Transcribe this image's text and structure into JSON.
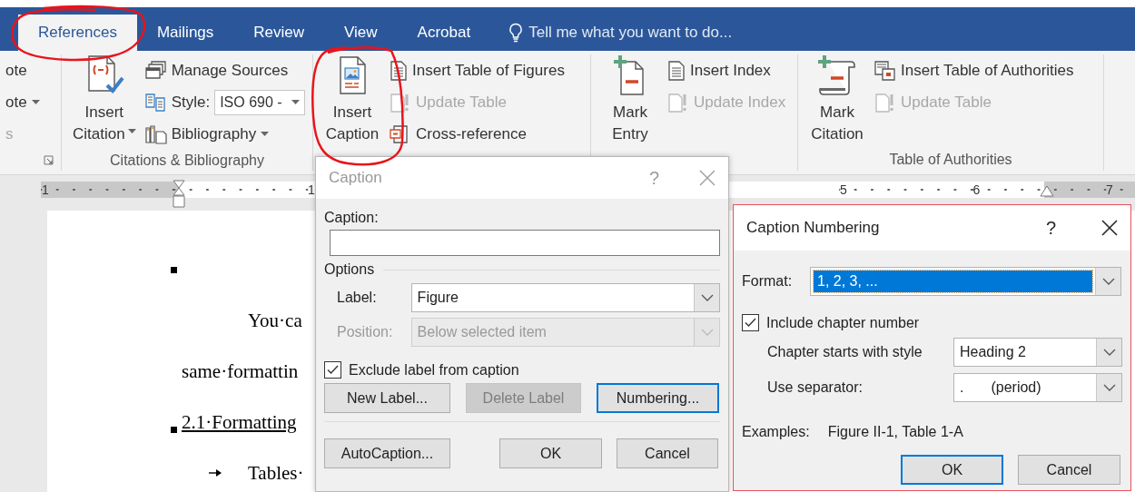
{
  "tabs": [
    {
      "label": "References",
      "selected": true
    },
    {
      "label": "Mailings",
      "selected": false
    },
    {
      "label": "Review",
      "selected": false
    },
    {
      "label": "View",
      "selected": false
    },
    {
      "label": "Acrobat",
      "selected": false
    }
  ],
  "tell_me": {
    "placeholder": "Tell me what you want to do..."
  },
  "ribbon": {
    "groups": [
      {
        "launcher": true,
        "small": [
          {
            "kind": "button",
            "label": "ote",
            "disabled": false,
            "dropdown": false
          },
          {
            "kind": "button",
            "label": "ote",
            "disabled": false,
            "dropdown": true
          },
          {
            "kind": "button",
            "label": "s",
            "disabled": true,
            "dropdown": false
          }
        ]
      },
      {
        "label": "Citations & Bibliography",
        "launcher": false,
        "large": [
          {
            "lines": [
              "Insert",
              "Citation"
            ],
            "dropdown": true
          }
        ],
        "small": [
          {
            "kind": "button",
            "label": "Manage Sources",
            "disabled": false,
            "dropdown": false
          },
          {
            "kind": "combo",
            "label": "Style:",
            "value": "ISO 690 -",
            "disabled": false,
            "dropdown": true
          },
          {
            "kind": "button",
            "label": "Bibliography",
            "disabled": false,
            "dropdown": true
          }
        ]
      },
      {
        "launcher": false,
        "large": [
          {
            "lines": [
              "Insert",
              "Caption"
            ],
            "dropdown": false
          }
        ],
        "small": [
          {
            "kind": "button",
            "label": "Insert Table of Figures",
            "disabled": false,
            "dropdown": false
          },
          {
            "kind": "button",
            "label": "Update Table",
            "disabled": true,
            "dropdown": false
          },
          {
            "kind": "button",
            "label": "Cross-reference",
            "disabled": false,
            "dropdown": false
          }
        ]
      },
      {
        "launcher": false,
        "large": [
          {
            "lines": [
              "Mark",
              "Entry"
            ],
            "dropdown": false
          }
        ],
        "small": [
          {
            "kind": "button",
            "label": "Insert Index",
            "disabled": false,
            "dropdown": false
          },
          {
            "kind": "button",
            "label": "Update Index",
            "disabled": true,
            "dropdown": false
          }
        ]
      },
      {
        "label": "Table of Authorities",
        "launcher": false,
        "large": [
          {
            "lines": [
              "Mark",
              "Citation"
            ],
            "dropdown": false
          }
        ],
        "small": [
          {
            "kind": "button",
            "label": "Insert Table of Authorities",
            "disabled": false,
            "dropdown": false
          },
          {
            "kind": "button",
            "label": "Update Table",
            "disabled": true,
            "dropdown": false
          }
        ]
      }
    ]
  },
  "ruler": {
    "marks": [
      "1",
      "1",
      "5",
      "6",
      "7"
    ]
  },
  "document": {
    "lines": [
      {
        "kind": "mark"
      },
      {
        "kind": "first-line",
        "text": "You·ca"
      },
      {
        "kind": "body",
        "text": "same·formattin"
      },
      {
        "kind": "heading",
        "text": "2.1·Formatting"
      },
      {
        "kind": "tab",
        "text": "Tables·"
      }
    ]
  },
  "caption_dialog": {
    "title": "Caption",
    "active": false,
    "help": "?",
    "caption_field": {
      "label": "Caption:"
    },
    "options_heading": "Options",
    "label_field": {
      "label": "Label:",
      "value": "Figure",
      "disabled": false
    },
    "position_field": {
      "label": "Position:",
      "value": "Below selected item",
      "disabled": true
    },
    "exclude_checkbox": {
      "label": "Exclude label from caption",
      "checked": true
    },
    "buttons": [
      {
        "label": "New Label...",
        "disabled": false,
        "default": false
      },
      {
        "label": "Delete Label",
        "disabled": true,
        "default": false
      },
      {
        "label": "Numbering...",
        "disabled": false,
        "default": true
      }
    ],
    "footer_buttons": [
      {
        "label": "AutoCaption...",
        "disabled": false,
        "default": false
      },
      {
        "label": "OK",
        "disabled": false,
        "default": false
      },
      {
        "label": "Cancel",
        "disabled": false,
        "default": false
      }
    ]
  },
  "numbering_dialog": {
    "title": "Caption Numbering",
    "active": true,
    "help": "?",
    "format_field": {
      "label": "Format:",
      "value": "1, 2, 3, ...",
      "selected": true
    },
    "chapter_checkbox": {
      "label": "Include chapter number",
      "checked": true
    },
    "style_field": {
      "label": "Chapter starts with style",
      "value": "Heading 2"
    },
    "separator_field": {
      "label": "Use separator:",
      "value": ".",
      "value_note": "(period)"
    },
    "examples": {
      "label": "Examples:",
      "value": "Figure II-1, Table 1-A"
    },
    "buttons": [
      {
        "label": "OK",
        "default": true
      },
      {
        "label": "Cancel",
        "default": false
      }
    ]
  }
}
